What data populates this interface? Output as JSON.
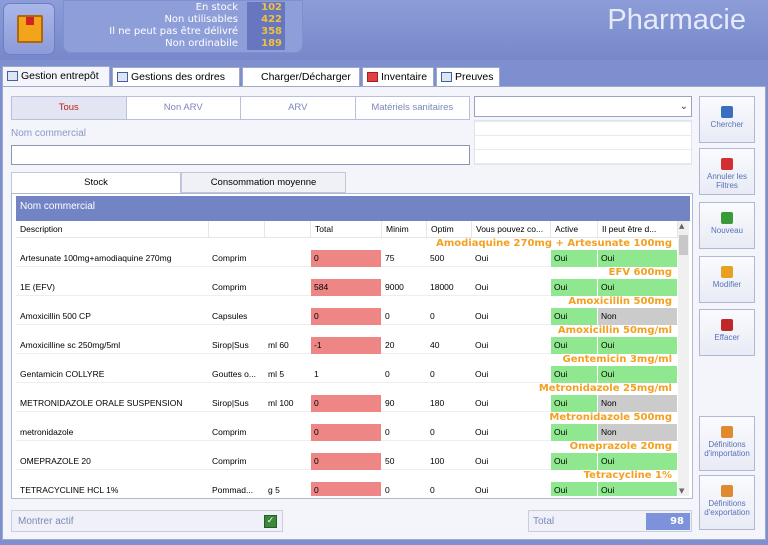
{
  "header": {
    "app_title": "Pharmacie",
    "stats": [
      {
        "label": "En stock",
        "value": "102"
      },
      {
        "label": "Non utilisables",
        "value": "422"
      },
      {
        "label": "Il ne peut pas être délivré",
        "value": "358"
      },
      {
        "label": "Non ordinabile",
        "value": "189"
      }
    ]
  },
  "tabs": [
    {
      "label": "Gestion entrepôt",
      "active": true
    },
    {
      "label": "Gestions des ordres"
    },
    {
      "label": "Charger/Décharger"
    },
    {
      "label": "Inventaire"
    },
    {
      "label": "Preuves"
    }
  ],
  "filters": [
    "Tous",
    "Non ARV",
    "ARV",
    "Matériels sanitaires"
  ],
  "search": {
    "label": "Nom commercial",
    "value": ""
  },
  "subtabs": [
    "Stock",
    "Consommation moyenne"
  ],
  "grid": {
    "group_header": "Nom commercial",
    "columns": [
      "Description",
      "",
      "",
      "Total",
      "Minim",
      "Optim",
      "Vous pouvez co...",
      "Active",
      "Il peut être d..."
    ],
    "rows": [
      {
        "group": "Amodiaquine 270mg + Artesunate 100mg",
        "description": "Artesunate 100mg+amodiaquine 270mg",
        "form": "Comprim",
        "volume": "",
        "total": "0",
        "minim": "75",
        "optim": "500",
        "can_order": "Oui",
        "active": "Oui",
        "deliverable": "Oui"
      },
      {
        "group": "EFV 600mg",
        "description": "1E (EFV)",
        "form": "Comprim",
        "volume": "",
        "total": "584",
        "minim": "9000",
        "optim": "18000",
        "can_order": "Oui",
        "active": "Oui",
        "deliverable": "Oui"
      },
      {
        "group": "Amoxicillin 500mg",
        "description": "Amoxicillin 500 CP",
        "form": "Capsules",
        "volume": "",
        "total": "0",
        "minim": "0",
        "optim": "0",
        "can_order": "Oui",
        "active": "Oui",
        "deliverable": "Non"
      },
      {
        "group": "Amoxicillin 50mg/ml",
        "description": "Amoxicilline sc  250mg/5ml",
        "form": "Sirop|Sus",
        "volume": "ml 60",
        "total": "-1",
        "minim": "20",
        "optim": "40",
        "can_order": "Oui",
        "active": "Oui",
        "deliverable": "Oui"
      },
      {
        "group": "Gentemicin 3mg/ml",
        "description": "Gentamicin COLLYRE",
        "form": "Gouttes o...",
        "volume": "ml 5",
        "total": "1",
        "minim": "0",
        "optim": "0",
        "can_order": "Oui",
        "active": "Oui",
        "deliverable": "Oui"
      },
      {
        "group": "Metronidazole 25mg/ml",
        "description": "METRONIDAZOLE ORALE SUSPENSION",
        "form": "Sirop|Sus",
        "volume": "ml 100",
        "total": "0",
        "minim": "90",
        "optim": "180",
        "can_order": "Oui",
        "active": "Oui",
        "deliverable": "Non"
      },
      {
        "group": "Metronidazole 500mg",
        "description": "metronidazole",
        "form": "Comprim",
        "volume": "",
        "total": "0",
        "minim": "0",
        "optim": "0",
        "can_order": "Oui",
        "active": "Oui",
        "deliverable": "Non"
      },
      {
        "group": "Omeprazole 20mg",
        "description": "OMEPRAZOLE 20",
        "form": "Comprim",
        "volume": "",
        "total": "0",
        "minim": "50",
        "optim": "100",
        "can_order": "Oui",
        "active": "Oui",
        "deliverable": "Oui"
      },
      {
        "group": "Tetracycline 1%",
        "description": "TETRACYCLINE HCL 1%",
        "form": "Pommad...",
        "volume": "g 5",
        "total": "0",
        "minim": "0",
        "optim": "0",
        "can_order": "Oui",
        "active": "Oui",
        "deliverable": "Oui"
      }
    ]
  },
  "side_buttons": [
    {
      "name": "search-button",
      "icon": "search-icon",
      "label": "Chercher",
      "color": "#3a6fc0"
    },
    {
      "name": "clear-filters-button",
      "icon": "close-icon",
      "label": "Annuler les Filtres",
      "color": "#d03030"
    },
    {
      "name": "new-button",
      "icon": "plus-icon",
      "label": "Nouveau",
      "color": "#3a9a3a"
    },
    {
      "name": "edit-button",
      "icon": "pencil-icon",
      "label": "Modifier",
      "color": "#e8a020"
    },
    {
      "name": "delete-button",
      "icon": "trash-icon",
      "label": "Effacer",
      "color": "#c02828"
    },
    {
      "name": "import-definitions-button",
      "icon": "xml-file-icon",
      "label": "Définitions d'importation",
      "color": "#e08a30"
    },
    {
      "name": "export-definitions-button",
      "icon": "xml-file-icon",
      "label": "Définitions d'exportation",
      "color": "#e08a30"
    }
  ],
  "footer": {
    "show_active_label": "Montrer actif",
    "show_active_checked": true,
    "total_label": "Total",
    "total_value": "98"
  }
}
